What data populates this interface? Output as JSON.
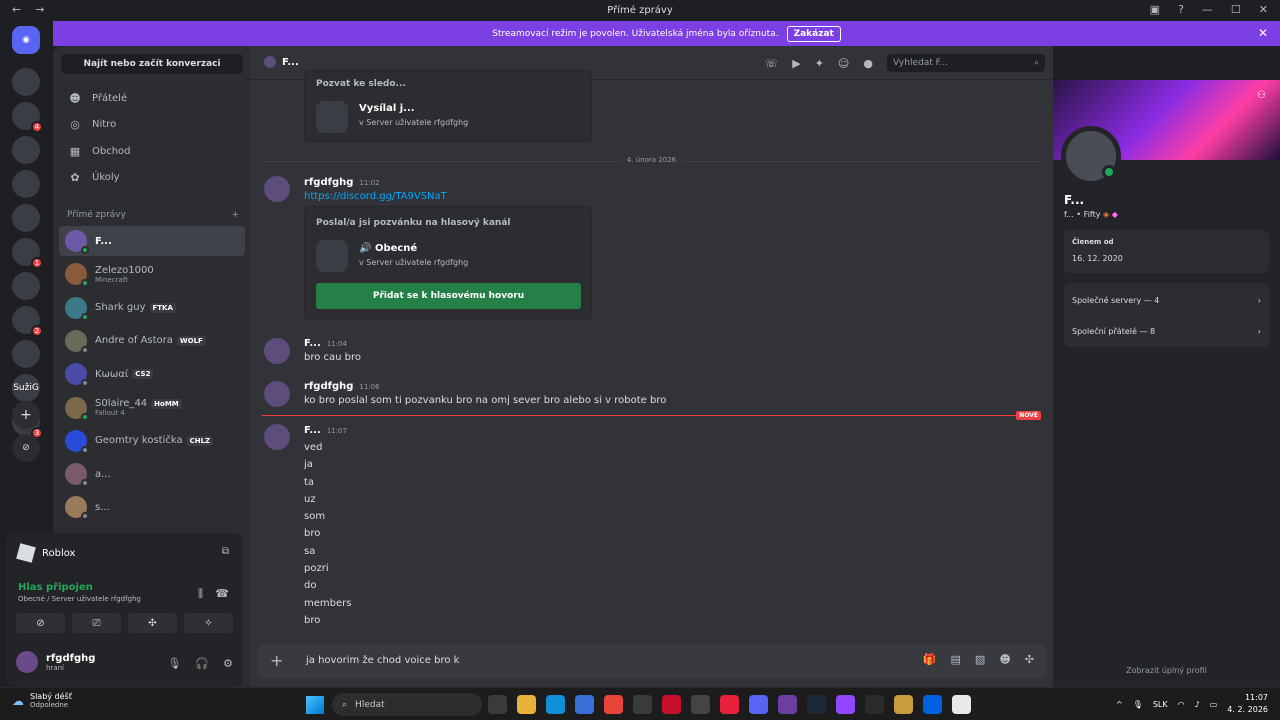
{
  "window": {
    "title": "Přímé zprávy",
    "nav_back": "←",
    "nav_fwd": "→"
  },
  "banner": {
    "text": "Streamovací režim je povolen. Uživatelská jména byla oříznuta.",
    "button": "Zakázat"
  },
  "servers": [
    {
      "label": "",
      "badge": ""
    },
    {
      "label": "",
      "badge": "4"
    },
    {
      "label": "",
      "badge": ""
    },
    {
      "label": "",
      "badge": ""
    },
    {
      "label": "",
      "badge": ""
    },
    {
      "label": "",
      "badge": "1"
    },
    {
      "label": "",
      "badge": ""
    },
    {
      "label": "",
      "badge": "2"
    },
    {
      "label": "",
      "badge": ""
    },
    {
      "label": "SužiG",
      "badge": ""
    },
    {
      "label": "",
      "badge": "3"
    }
  ],
  "dmcol": {
    "find": "Najít nebo začít konverzaci",
    "nav": [
      {
        "label": "Přátelé",
        "icon": "friends-icon"
      },
      {
        "label": "Nitro",
        "icon": "nitro-icon"
      },
      {
        "label": "Obchod",
        "icon": "shop-icon"
      },
      {
        "label": "Úkoly",
        "icon": "quests-icon"
      }
    ],
    "dm_header": "Přímé zprávy",
    "dms": [
      {
        "name": "F...",
        "sub": "",
        "tag": "",
        "active": true,
        "online": true
      },
      {
        "name": "Zelezo1000",
        "sub": "Minecraft",
        "tag": "",
        "active": false,
        "online": true
      },
      {
        "name": "Shark guy",
        "sub": "",
        "tag": "FTKA",
        "active": false,
        "online": true
      },
      {
        "name": "Andre of Astora",
        "sub": "",
        "tag": "WOLF",
        "active": false,
        "online": false
      },
      {
        "name": "Kωωαί",
        "sub": "",
        "tag": "CS2",
        "active": false,
        "online": false
      },
      {
        "name": "S0laire_44",
        "sub": "Fallout 4",
        "tag": "HoMM",
        "active": false,
        "online": true
      },
      {
        "name": "Geomtry kostička",
        "sub": "",
        "tag": "CHLZ",
        "active": false,
        "online": false
      },
      {
        "name": "a...",
        "sub": "",
        "tag": "",
        "active": false,
        "online": false
      },
      {
        "name": "s...",
        "sub": "",
        "tag": "",
        "active": false,
        "online": false
      }
    ]
  },
  "activity": {
    "game": "Roblox",
    "voice_status": "Hlas připojen",
    "voice_channel": "Obecné / Server uživatele rfgdfghg",
    "username": "rfgdfghg",
    "user_status": "hraní"
  },
  "chat": {
    "header_name": "F...",
    "search_placeholder": "Vyhledat F...",
    "card1_title": "Pozvat ke sledo...",
    "card1_name": "Vysílal j...",
    "card1_server": "v Server uživatele rfgdfghg",
    "date_divider": "4. února 2026",
    "messages": [
      {
        "author": "rfgdfghg",
        "time": "11:02",
        "link": "https://discord.gg/TA9VSNaT"
      },
      {
        "author": "F...",
        "time": "11:04",
        "text": "bro cau bro"
      },
      {
        "author": "rfgdfghg",
        "time": "11:06",
        "text": "ko bro poslal som ti pozvanku bro na omj sever bro alebo si v robote bro"
      },
      {
        "author": "F...",
        "time": "11:07"
      }
    ],
    "invite_title": "Poslal/a jsi pozvánku na hlasový kanál",
    "invite_channel": "Obecné",
    "invite_server": "v Server uživatele rfgdfghg",
    "invite_button": "Přidat se k hlasovému hovoru",
    "new_label": "NOVÉ",
    "lines": [
      "ved",
      "ja",
      "ta",
      "uz",
      "som",
      "bro",
      "sa",
      "pozri",
      "do",
      "members",
      "bro"
    ],
    "composer_text": "ja hovorim  že chod voice bro k"
  },
  "profile": {
    "name": "F...",
    "sub": "f... • Fifty",
    "member_label": "Členem od",
    "member_date": "16. 12. 2020",
    "servers": "Společné servery — 4",
    "friends": "Společní přátelé — 8",
    "full": "Zobrazit úplný profil"
  },
  "taskbar": {
    "weather_title": "Slabý déšť",
    "weather_sub": "Odpoledne",
    "search": "Hledat",
    "lang": "SLK",
    "time": "11:07",
    "date": "4. 2. 2026"
  }
}
